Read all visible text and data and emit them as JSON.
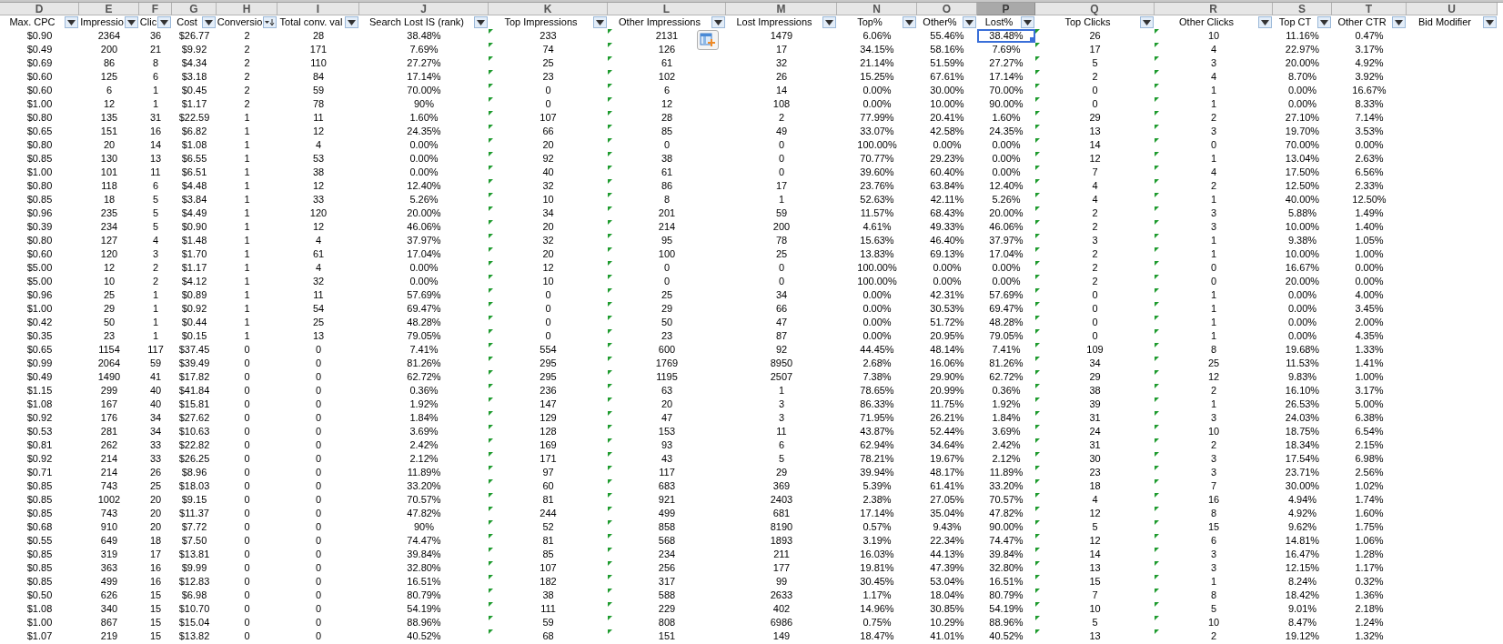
{
  "columns": [
    {
      "letter": "D",
      "header": "Max. CPC",
      "kind": "filter",
      "selected": false,
      "flagged": false
    },
    {
      "letter": "E",
      "header": "Impressio",
      "kind": "filter",
      "selected": false,
      "flagged": false
    },
    {
      "letter": "F",
      "header": "Clic",
      "kind": "filter",
      "selected": false,
      "flagged": false
    },
    {
      "letter": "G",
      "header": "Cost",
      "kind": "filter",
      "selected": false,
      "flagged": false
    },
    {
      "letter": "H",
      "header": "Conversio",
      "kind": "sorted",
      "selected": false,
      "flagged": false
    },
    {
      "letter": "I",
      "header": "Total conv. val",
      "kind": "filter",
      "selected": false,
      "flagged": false
    },
    {
      "letter": "J",
      "header": "Search Lost IS (rank)",
      "kind": "filter",
      "selected": false,
      "flagged": false
    },
    {
      "letter": "K",
      "header": "Top Impressions",
      "kind": "filter",
      "selected": false,
      "flagged": true
    },
    {
      "letter": "L",
      "header": "Other Impressions",
      "kind": "filter",
      "selected": false,
      "flagged": true
    },
    {
      "letter": "M",
      "header": "Lost Impressions",
      "kind": "filter",
      "selected": false,
      "flagged": false
    },
    {
      "letter": "N",
      "header": "Top%",
      "kind": "filter",
      "selected": false,
      "flagged": false
    },
    {
      "letter": "O",
      "header": "Other%",
      "kind": "filter",
      "selected": false,
      "flagged": false
    },
    {
      "letter": "P",
      "header": "Lost%",
      "kind": "filter",
      "selected": true,
      "flagged": false
    },
    {
      "letter": "Q",
      "header": "Top Clicks",
      "kind": "filter",
      "selected": false,
      "flagged": true
    },
    {
      "letter": "R",
      "header": "Other Clicks",
      "kind": "filter",
      "selected": false,
      "flagged": true
    },
    {
      "letter": "S",
      "header": "Top CT",
      "kind": "filter",
      "selected": false,
      "flagged": false
    },
    {
      "letter": "T",
      "header": "Other CTR",
      "kind": "filter",
      "selected": false,
      "flagged": false
    },
    {
      "letter": "U",
      "header": "Bid Modifier",
      "kind": "filter",
      "selected": false,
      "flagged": false
    }
  ],
  "rows": [
    {
      "selected": true,
      "cells": [
        "$0.90",
        "2364",
        "36",
        "$26.77",
        "2",
        "28",
        "38.48%",
        "233",
        "2131",
        "1479",
        "6.06%",
        "55.46%",
        "38.48%",
        "26",
        "10",
        "11.16%",
        "0.47%"
      ]
    },
    {
      "selected": false,
      "cells": [
        "$0.49",
        "200",
        "21",
        "$9.92",
        "2",
        "171",
        "7.69%",
        "74",
        "126",
        "17",
        "34.15%",
        "58.16%",
        "7.69%",
        "17",
        "4",
        "22.97%",
        "3.17%"
      ]
    },
    {
      "selected": false,
      "cells": [
        "$0.69",
        "86",
        "8",
        "$4.34",
        "2",
        "110",
        "27.27%",
        "25",
        "61",
        "32",
        "21.14%",
        "51.59%",
        "27.27%",
        "5",
        "3",
        "20.00%",
        "4.92%"
      ]
    },
    {
      "selected": false,
      "cells": [
        "$0.60",
        "125",
        "6",
        "$3.18",
        "2",
        "84",
        "17.14%",
        "23",
        "102",
        "26",
        "15.25%",
        "67.61%",
        "17.14%",
        "2",
        "4",
        "8.70%",
        "3.92%"
      ]
    },
    {
      "selected": false,
      "cells": [
        "$0.60",
        "6",
        "1",
        "$0.45",
        "2",
        "59",
        "70.00%",
        "0",
        "6",
        "14",
        "0.00%",
        "30.00%",
        "70.00%",
        "0",
        "1",
        "0.00%",
        "16.67%"
      ]
    },
    {
      "selected": false,
      "cells": [
        "$1.00",
        "12",
        "1",
        "$1.17",
        "2",
        "78",
        "90%",
        "0",
        "12",
        "108",
        "0.00%",
        "10.00%",
        "90.00%",
        "0",
        "1",
        "0.00%",
        "8.33%"
      ]
    },
    {
      "selected": false,
      "cells": [
        "$0.80",
        "135",
        "31",
        "$22.59",
        "1",
        "11",
        "1.60%",
        "107",
        "28",
        "2",
        "77.99%",
        "20.41%",
        "1.60%",
        "29",
        "2",
        "27.10%",
        "7.14%"
      ]
    },
    {
      "selected": false,
      "cells": [
        "$0.65",
        "151",
        "16",
        "$6.82",
        "1",
        "12",
        "24.35%",
        "66",
        "85",
        "49",
        "33.07%",
        "42.58%",
        "24.35%",
        "13",
        "3",
        "19.70%",
        "3.53%"
      ]
    },
    {
      "selected": false,
      "cells": [
        "$0.80",
        "20",
        "14",
        "$1.08",
        "1",
        "4",
        "0.00%",
        "20",
        "0",
        "0",
        "100.00%",
        "0.00%",
        "0.00%",
        "14",
        "0",
        "70.00%",
        "0.00%"
      ]
    },
    {
      "selected": false,
      "cells": [
        "$0.85",
        "130",
        "13",
        "$6.55",
        "1",
        "53",
        "0.00%",
        "92",
        "38",
        "0",
        "70.77%",
        "29.23%",
        "0.00%",
        "12",
        "1",
        "13.04%",
        "2.63%"
      ]
    },
    {
      "selected": false,
      "cells": [
        "$1.00",
        "101",
        "11",
        "$6.51",
        "1",
        "38",
        "0.00%",
        "40",
        "61",
        "0",
        "39.60%",
        "60.40%",
        "0.00%",
        "7",
        "4",
        "17.50%",
        "6.56%"
      ]
    },
    {
      "selected": false,
      "cells": [
        "$0.80",
        "118",
        "6",
        "$4.48",
        "1",
        "12",
        "12.40%",
        "32",
        "86",
        "17",
        "23.76%",
        "63.84%",
        "12.40%",
        "4",
        "2",
        "12.50%",
        "2.33%"
      ]
    },
    {
      "selected": false,
      "cells": [
        "$0.85",
        "18",
        "5",
        "$3.84",
        "1",
        "33",
        "5.26%",
        "10",
        "8",
        "1",
        "52.63%",
        "42.11%",
        "5.26%",
        "4",
        "1",
        "40.00%",
        "12.50%"
      ]
    },
    {
      "selected": false,
      "cells": [
        "$0.96",
        "235",
        "5",
        "$4.49",
        "1",
        "120",
        "20.00%",
        "34",
        "201",
        "59",
        "11.57%",
        "68.43%",
        "20.00%",
        "2",
        "3",
        "5.88%",
        "1.49%"
      ]
    },
    {
      "selected": false,
      "cells": [
        "$0.39",
        "234",
        "5",
        "$0.90",
        "1",
        "12",
        "46.06%",
        "20",
        "214",
        "200",
        "4.61%",
        "49.33%",
        "46.06%",
        "2",
        "3",
        "10.00%",
        "1.40%"
      ]
    },
    {
      "selected": false,
      "cells": [
        "$0.80",
        "127",
        "4",
        "$1.48",
        "1",
        "4",
        "37.97%",
        "32",
        "95",
        "78",
        "15.63%",
        "46.40%",
        "37.97%",
        "3",
        "1",
        "9.38%",
        "1.05%"
      ]
    },
    {
      "selected": false,
      "cells": [
        "$0.60",
        "120",
        "3",
        "$1.70",
        "1",
        "61",
        "17.04%",
        "20",
        "100",
        "25",
        "13.83%",
        "69.13%",
        "17.04%",
        "2",
        "1",
        "10.00%",
        "1.00%"
      ]
    },
    {
      "selected": false,
      "cells": [
        "$5.00",
        "12",
        "2",
        "$1.17",
        "1",
        "4",
        "0.00%",
        "12",
        "0",
        "0",
        "100.00%",
        "0.00%",
        "0.00%",
        "2",
        "0",
        "16.67%",
        "0.00%"
      ]
    },
    {
      "selected": false,
      "cells": [
        "$5.00",
        "10",
        "2",
        "$4.12",
        "1",
        "32",
        "0.00%",
        "10",
        "0",
        "0",
        "100.00%",
        "0.00%",
        "0.00%",
        "2",
        "0",
        "20.00%",
        "0.00%"
      ]
    },
    {
      "selected": false,
      "cells": [
        "$0.96",
        "25",
        "1",
        "$0.89",
        "1",
        "11",
        "57.69%",
        "0",
        "25",
        "34",
        "0.00%",
        "42.31%",
        "57.69%",
        "0",
        "1",
        "0.00%",
        "4.00%"
      ]
    },
    {
      "selected": false,
      "cells": [
        "$1.00",
        "29",
        "1",
        "$0.92",
        "1",
        "54",
        "69.47%",
        "0",
        "29",
        "66",
        "0.00%",
        "30.53%",
        "69.47%",
        "0",
        "1",
        "0.00%",
        "3.45%"
      ]
    },
    {
      "selected": false,
      "cells": [
        "$0.42",
        "50",
        "1",
        "$0.44",
        "1",
        "25",
        "48.28%",
        "0",
        "50",
        "47",
        "0.00%",
        "51.72%",
        "48.28%",
        "0",
        "1",
        "0.00%",
        "2.00%"
      ]
    },
    {
      "selected": false,
      "cells": [
        "$0.35",
        "23",
        "1",
        "$0.15",
        "1",
        "13",
        "79.05%",
        "0",
        "23",
        "87",
        "0.00%",
        "20.95%",
        "79.05%",
        "0",
        "1",
        "0.00%",
        "4.35%"
      ]
    },
    {
      "selected": false,
      "cells": [
        "$0.65",
        "1154",
        "117",
        "$37.45",
        "0",
        "0",
        "7.41%",
        "554",
        "600",
        "92",
        "44.45%",
        "48.14%",
        "7.41%",
        "109",
        "8",
        "19.68%",
        "1.33%"
      ]
    },
    {
      "selected": false,
      "cells": [
        "$0.99",
        "2064",
        "59",
        "$39.49",
        "0",
        "0",
        "81.26%",
        "295",
        "1769",
        "8950",
        "2.68%",
        "16.06%",
        "81.26%",
        "34",
        "25",
        "11.53%",
        "1.41%"
      ]
    },
    {
      "selected": false,
      "cells": [
        "$0.49",
        "1490",
        "41",
        "$17.82",
        "0",
        "0",
        "62.72%",
        "295",
        "1195",
        "2507",
        "7.38%",
        "29.90%",
        "62.72%",
        "29",
        "12",
        "9.83%",
        "1.00%"
      ]
    },
    {
      "selected": false,
      "cells": [
        "$1.15",
        "299",
        "40",
        "$41.84",
        "0",
        "0",
        "0.36%",
        "236",
        "63",
        "1",
        "78.65%",
        "20.99%",
        "0.36%",
        "38",
        "2",
        "16.10%",
        "3.17%"
      ]
    },
    {
      "selected": false,
      "cells": [
        "$1.08",
        "167",
        "40",
        "$15.81",
        "0",
        "0",
        "1.92%",
        "147",
        "20",
        "3",
        "86.33%",
        "11.75%",
        "1.92%",
        "39",
        "1",
        "26.53%",
        "5.00%"
      ]
    },
    {
      "selected": false,
      "cells": [
        "$0.92",
        "176",
        "34",
        "$27.62",
        "0",
        "0",
        "1.84%",
        "129",
        "47",
        "3",
        "71.95%",
        "26.21%",
        "1.84%",
        "31",
        "3",
        "24.03%",
        "6.38%"
      ]
    },
    {
      "selected": false,
      "cells": [
        "$0.53",
        "281",
        "34",
        "$10.63",
        "0",
        "0",
        "3.69%",
        "128",
        "153",
        "11",
        "43.87%",
        "52.44%",
        "3.69%",
        "24",
        "10",
        "18.75%",
        "6.54%"
      ]
    },
    {
      "selected": false,
      "cells": [
        "$0.81",
        "262",
        "33",
        "$22.82",
        "0",
        "0",
        "2.42%",
        "169",
        "93",
        "6",
        "62.94%",
        "34.64%",
        "2.42%",
        "31",
        "2",
        "18.34%",
        "2.15%"
      ]
    },
    {
      "selected": false,
      "cells": [
        "$0.92",
        "214",
        "33",
        "$26.25",
        "0",
        "0",
        "2.12%",
        "171",
        "43",
        "5",
        "78.21%",
        "19.67%",
        "2.12%",
        "30",
        "3",
        "17.54%",
        "6.98%"
      ]
    },
    {
      "selected": false,
      "cells": [
        "$0.71",
        "214",
        "26",
        "$8.96",
        "0",
        "0",
        "11.89%",
        "97",
        "117",
        "29",
        "39.94%",
        "48.17%",
        "11.89%",
        "23",
        "3",
        "23.71%",
        "2.56%"
      ]
    },
    {
      "selected": false,
      "cells": [
        "$0.85",
        "743",
        "25",
        "$18.03",
        "0",
        "0",
        "33.20%",
        "60",
        "683",
        "369",
        "5.39%",
        "61.41%",
        "33.20%",
        "18",
        "7",
        "30.00%",
        "1.02%"
      ]
    },
    {
      "selected": false,
      "cells": [
        "$0.85",
        "1002",
        "20",
        "$9.15",
        "0",
        "0",
        "70.57%",
        "81",
        "921",
        "2403",
        "2.38%",
        "27.05%",
        "70.57%",
        "4",
        "16",
        "4.94%",
        "1.74%"
      ]
    },
    {
      "selected": false,
      "cells": [
        "$0.85",
        "743",
        "20",
        "$11.37",
        "0",
        "0",
        "47.82%",
        "244",
        "499",
        "681",
        "17.14%",
        "35.04%",
        "47.82%",
        "12",
        "8",
        "4.92%",
        "1.60%"
      ]
    },
    {
      "selected": false,
      "cells": [
        "$0.68",
        "910",
        "20",
        "$7.72",
        "0",
        "0",
        "90%",
        "52",
        "858",
        "8190",
        "0.57%",
        "9.43%",
        "90.00%",
        "5",
        "15",
        "9.62%",
        "1.75%"
      ]
    },
    {
      "selected": false,
      "cells": [
        "$0.55",
        "649",
        "18",
        "$7.50",
        "0",
        "0",
        "74.47%",
        "81",
        "568",
        "1893",
        "3.19%",
        "22.34%",
        "74.47%",
        "12",
        "6",
        "14.81%",
        "1.06%"
      ]
    },
    {
      "selected": false,
      "cells": [
        "$0.85",
        "319",
        "17",
        "$13.81",
        "0",
        "0",
        "39.84%",
        "85",
        "234",
        "211",
        "16.03%",
        "44.13%",
        "39.84%",
        "14",
        "3",
        "16.47%",
        "1.28%"
      ]
    },
    {
      "selected": false,
      "cells": [
        "$0.85",
        "363",
        "16",
        "$9.99",
        "0",
        "0",
        "32.80%",
        "107",
        "256",
        "177",
        "19.81%",
        "47.39%",
        "32.80%",
        "13",
        "3",
        "12.15%",
        "1.17%"
      ]
    },
    {
      "selected": false,
      "cells": [
        "$0.85",
        "499",
        "16",
        "$12.83",
        "0",
        "0",
        "16.51%",
        "182",
        "317",
        "99",
        "30.45%",
        "53.04%",
        "16.51%",
        "15",
        "1",
        "8.24%",
        "0.32%"
      ]
    },
    {
      "selected": false,
      "cells": [
        "$0.50",
        "626",
        "15",
        "$6.98",
        "0",
        "0",
        "80.79%",
        "38",
        "588",
        "2633",
        "1.17%",
        "18.04%",
        "80.79%",
        "7",
        "8",
        "18.42%",
        "1.36%"
      ]
    },
    {
      "selected": false,
      "cells": [
        "$1.08",
        "340",
        "15",
        "$10.70",
        "0",
        "0",
        "54.19%",
        "111",
        "229",
        "402",
        "14.96%",
        "30.85%",
        "54.19%",
        "10",
        "5",
        "9.01%",
        "2.18%"
      ]
    },
    {
      "selected": false,
      "cells": [
        "$1.00",
        "867",
        "15",
        "$15.04",
        "0",
        "0",
        "88.96%",
        "59",
        "808",
        "6986",
        "0.75%",
        "10.29%",
        "88.96%",
        "5",
        "10",
        "8.47%",
        "1.24%"
      ]
    },
    {
      "selected": false,
      "cells": [
        "$1.07",
        "219",
        "15",
        "$13.82",
        "0",
        "0",
        "40.52%",
        "68",
        "151",
        "149",
        "18.47%",
        "41.01%",
        "40.52%",
        "13",
        "2",
        "19.12%",
        "1.32%"
      ]
    }
  ]
}
